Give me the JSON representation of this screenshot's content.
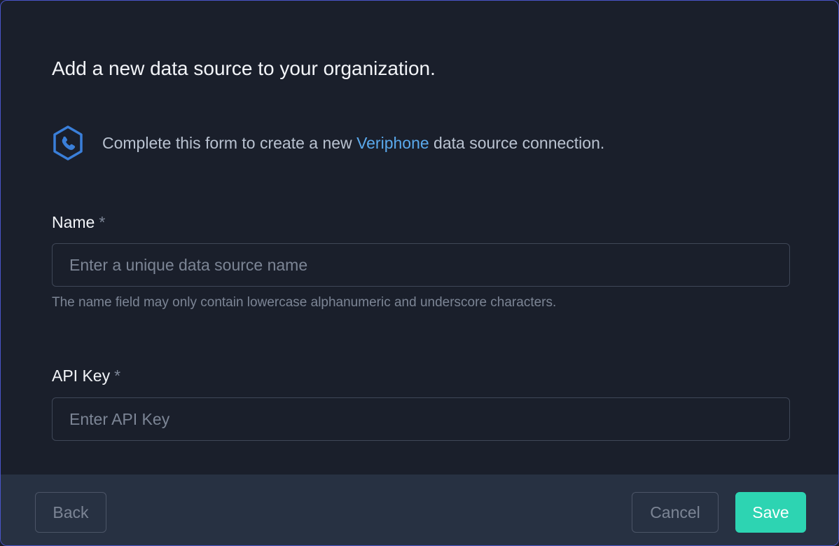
{
  "dialog": {
    "title": "Add a new data source to your organization.",
    "description_prefix": "Complete this form to create a new ",
    "description_brand": "Veriphone",
    "description_suffix": " data source connection.",
    "brand_icon": "veriphone-phone-hex-icon",
    "brand_color": "#5aa9ec"
  },
  "fields": {
    "name": {
      "label": "Name",
      "required_marker": "*",
      "value": "",
      "placeholder": "Enter a unique data source name",
      "help": "The name field may only contain lowercase alphanumeric and underscore characters."
    },
    "api_key": {
      "label": "API Key",
      "required_marker": "*",
      "value": "",
      "placeholder": "Enter API Key"
    }
  },
  "footer": {
    "back_label": "Back",
    "cancel_label": "Cancel",
    "save_label": "Save",
    "save_color": "#2dd4b2"
  }
}
